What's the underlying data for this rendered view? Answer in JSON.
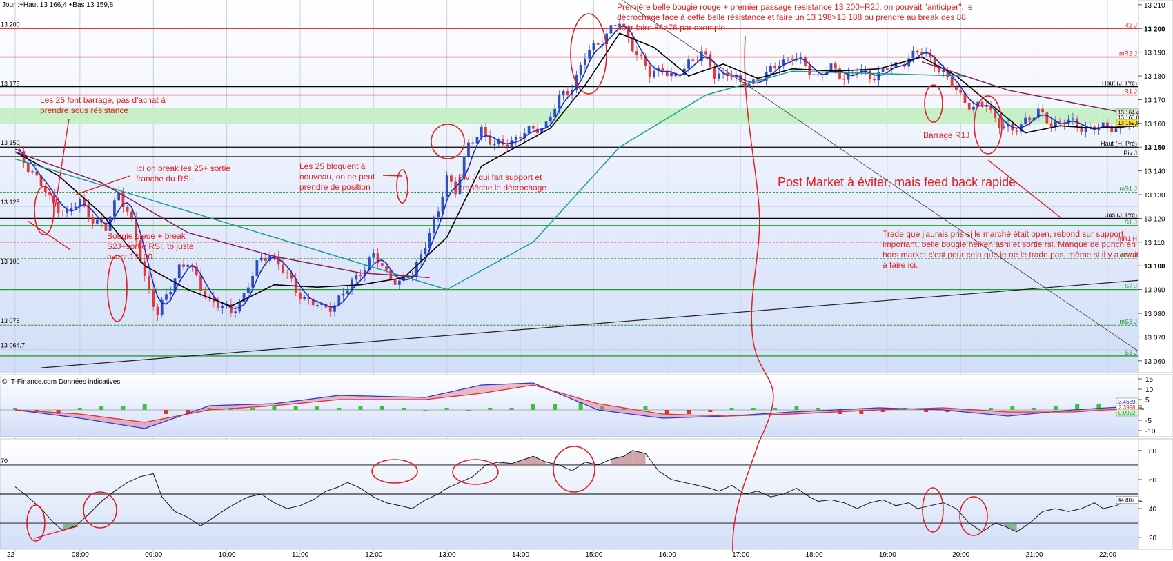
{
  "header": {
    "ohlc": "Jour :+Haut 13 166,4 +Bas 13 159,8",
    "source": "© IT-Finance.com  Données indicatives"
  },
  "colors": {
    "bull": "#2c4fc4",
    "bear": "#e23a3a",
    "ma_fast": "#1a2cc8",
    "ma_slow": "#000000",
    "ma_long1": "#1a9c96",
    "ma_long2": "#8a1a5a",
    "annotation": "#e02020",
    "zone": "#bfeec0",
    "panel_bg_top": "#ffffff",
    "panel_bg_bottom": "#d2def8"
  },
  "annotations": [
    "Première belle bougie rouge + premier passage resistance 13 200+R2J, on pouvait \"anticiper\", le décrochage face à cette belle résistance et faire un 13 198>13 188 ou prendre au break des 88 pour faire 86>76 par exemple",
    "Les 25 font barrage, pas d'achat à prendre sous résistance",
    "Ici on break les 25+ sortie franche du RSI.",
    "Les 25 bloquent à nouveau, on ne peut prendre de position",
    "Piv J qui fait support et empêche le décrochage",
    "Bougie bleue + break S2J+sortie RSI, tp juste avant  13100",
    "Barrage R1J",
    "Post Market à éviter, mais feed back rapide",
    "Trade que j'aurais pris si le marché était open, rebond sur support important, belle bougie heiken ashi et sortie rsi. Manque de punch en hors market c'est pour cela que je ne le trade pas, même si il y a avait à faire ici."
  ],
  "chart_data": [
    {
      "type": "candlestick",
      "x_ticks": [
        "22",
        "08:00",
        "09:00",
        "10:00",
        "11:00",
        "12:00",
        "13:00",
        "14:00",
        "15:00",
        "16:00",
        "17:00",
        "18:00",
        "19:00",
        "20:00",
        "21:00",
        "22:00"
      ],
      "ylim": [
        13055,
        13212
      ],
      "yticks": [
        "13 210",
        "13 200",
        "13 190",
        "13 180",
        "13 170",
        "13 160",
        "13 150",
        "13 140",
        "13 130",
        "13 120",
        "13 110",
        "13 100",
        "13 090",
        "13 080",
        "13 070",
        "13 060"
      ],
      "left_levels": [
        {
          "label": "13 200",
          "y": 13200
        },
        {
          "label": "13 175",
          "y": 13175
        },
        {
          "label": "13 150",
          "y": 13150
        },
        {
          "label": "13 125",
          "y": 13125
        },
        {
          "label": "13 100",
          "y": 13100
        },
        {
          "label": "13 075",
          "y": 13075
        },
        {
          "label": "13 064,7",
          "y": 13064.7
        }
      ],
      "levels": [
        {
          "name": "R2 J",
          "value": 13200,
          "color": "#e02020",
          "style": "solid"
        },
        {
          "name": "mR2 J",
          "value": 13188,
          "color": "#e02020",
          "style": "solid"
        },
        {
          "name": "Haut (J. Pré)",
          "value": 13175.5,
          "color": "#000000",
          "style": "solid"
        },
        {
          "name": "R1 J",
          "value": 13172,
          "color": "#e02020",
          "style": "solid"
        },
        {
          "name": "Haut (H. Pré)",
          "value": 13150,
          "color": "#000000",
          "style": "solid"
        },
        {
          "name": "Piv J",
          "value": 13146,
          "color": "#000000",
          "style": "solid"
        },
        {
          "name": "mS1 J",
          "value": 13131,
          "color": "#1f9c2a",
          "style": "dashed"
        },
        {
          "name": "Bas (J. Pré)",
          "value": 13120,
          "color": "#000000",
          "style": "solid"
        },
        {
          "name": "S1 J",
          "value": 13117,
          "color": "#1f9c2a",
          "style": "solid"
        },
        {
          "name": "mR1 H",
          "value": 13110,
          "color": "#e02020",
          "style": "dashed"
        },
        {
          "name": "mS2 J",
          "value": 13103,
          "color": "#1f9c2a",
          "style": "dashed"
        },
        {
          "name": "S2 J",
          "value": 13090,
          "color": "#1f9c2a",
          "style": "solid"
        },
        {
          "name": "mS3 J",
          "value": 13075,
          "color": "#1f9c2a",
          "style": "dashed"
        },
        {
          "name": "S3 J",
          "value": 13062,
          "color": "#1f9c2a",
          "style": "solid"
        }
      ],
      "price_tags": [
        "13 164,4",
        "13 160,0",
        "13 159,8"
      ],
      "zone": [
        13159.8,
        13166.4
      ],
      "close_path": [
        [
          0,
          13148
        ],
        [
          4,
          13140
        ],
        [
          8,
          13128
        ],
        [
          12,
          13122
        ],
        [
          15,
          13127
        ],
        [
          18,
          13120
        ],
        [
          21,
          13115
        ],
        [
          24,
          13132
        ],
        [
          27,
          13118
        ],
        [
          30,
          13095
        ],
        [
          33,
          13080
        ],
        [
          36,
          13090
        ],
        [
          38,
          13100
        ],
        [
          40,
          13102
        ],
        [
          43,
          13090
        ],
        [
          46,
          13085
        ],
        [
          50,
          13080
        ],
        [
          53,
          13088
        ],
        [
          56,
          13100
        ],
        [
          59,
          13106
        ],
        [
          62,
          13098
        ],
        [
          65,
          13090
        ],
        [
          68,
          13085
        ],
        [
          71,
          13082
        ],
        [
          74,
          13084
        ],
        [
          77,
          13090
        ],
        [
          80,
          13098
        ],
        [
          83,
          13104
        ],
        [
          86,
          13097
        ],
        [
          89,
          13093
        ],
        [
          92,
          13096
        ],
        [
          95,
          13110
        ],
        [
          98,
          13122
        ],
        [
          100,
          13138
        ],
        [
          102,
          13132
        ],
        [
          105,
          13150
        ],
        [
          108,
          13158
        ],
        [
          111,
          13150
        ],
        [
          114,
          13152
        ],
        [
          117,
          13155
        ],
        [
          120,
          13157
        ],
        [
          123,
          13160
        ],
        [
          126,
          13170
        ],
        [
          129,
          13176
        ],
        [
          132,
          13188
        ],
        [
          135,
          13194
        ],
        [
          138,
          13200
        ],
        [
          140,
          13202
        ],
        [
          142,
          13196
        ],
        [
          144,
          13190
        ],
        [
          147,
          13180
        ],
        [
          150,
          13184
        ],
        [
          153,
          13178
        ],
        [
          156,
          13186
        ],
        [
          159,
          13190
        ],
        [
          162,
          13180
        ],
        [
          165,
          13182
        ],
        [
          168,
          13176
        ],
        [
          171,
          13178
        ],
        [
          174,
          13180
        ],
        [
          177,
          13186
        ],
        [
          180,
          13188
        ],
        [
          183,
          13184
        ],
        [
          186,
          13180
        ],
        [
          189,
          13183
        ],
        [
          192,
          13180
        ],
        [
          195,
          13182
        ],
        [
          198,
          13180
        ],
        [
          201,
          13182
        ],
        [
          204,
          13184
        ],
        [
          207,
          13188
        ],
        [
          210,
          13190
        ],
        [
          213,
          13186
        ],
        [
          216,
          13178
        ],
        [
          219,
          13172
        ],
        [
          222,
          13166
        ],
        [
          225,
          13168
        ],
        [
          228,
          13160
        ],
        [
          231,
          13156
        ],
        [
          234,
          13162
        ],
        [
          237,
          13164
        ],
        [
          240,
          13160
        ],
        [
          243,
          13161
        ],
        [
          246,
          13159
        ],
        [
          249,
          13158
        ],
        [
          252,
          13158
        ],
        [
          255,
          13159
        ],
        [
          258,
          13160
        ],
        [
          261,
          13162
        ]
      ],
      "ma_slow_path": [
        [
          0,
          13148
        ],
        [
          10,
          13138
        ],
        [
          20,
          13122
        ],
        [
          30,
          13100
        ],
        [
          40,
          13090
        ],
        [
          50,
          13083
        ],
        [
          60,
          13092
        ],
        [
          70,
          13091
        ],
        [
          80,
          13092
        ],
        [
          90,
          13095
        ],
        [
          100,
          13112
        ],
        [
          108,
          13142
        ],
        [
          116,
          13150
        ],
        [
          124,
          13158
        ],
        [
          132,
          13176
        ],
        [
          140,
          13198
        ],
        [
          148,
          13192
        ],
        [
          156,
          13180
        ],
        [
          164,
          13185
        ],
        [
          172,
          13179
        ],
        [
          180,
          13183
        ],
        [
          190,
          13182
        ],
        [
          200,
          13183
        ],
        [
          210,
          13188
        ],
        [
          218,
          13180
        ],
        [
          226,
          13168
        ],
        [
          234,
          13156
        ],
        [
          242,
          13159
        ],
        [
          250,
          13158
        ],
        [
          261,
          13159
        ]
      ],
      "ma_long1_path": [
        [
          0,
          13145
        ],
        [
          100,
          13090
        ],
        [
          120,
          13110
        ],
        [
          140,
          13150
        ],
        [
          160,
          13172
        ],
        [
          180,
          13182
        ],
        [
          220,
          13180
        ]
      ],
      "ma_long2_path": [
        [
          0,
          13148
        ],
        [
          20,
          13135
        ],
        [
          40,
          13114
        ],
        [
          60,
          13104
        ],
        [
          80,
          13097
        ],
        [
          96,
          13095
        ]
      ],
      "ma_long2b_path": [
        [
          210,
          13186
        ],
        [
          230,
          13174
        ],
        [
          261,
          13163
        ]
      ],
      "trendlines": [
        [
          [
            6,
            13057
          ],
          [
            261,
            13094
          ]
        ],
        [
          [
            130,
            13225
          ],
          [
            261,
            13063
          ]
        ]
      ]
    },
    {
      "type": "histogram",
      "name": "MACD",
      "ylim": [
        -13,
        17
      ],
      "yticks": [
        "15",
        "10",
        "5",
        "-5",
        "-10"
      ],
      "tags": [
        "3,4639",
        "2,3998",
        "0,0922"
      ],
      "histogram": [
        1,
        -1,
        -2,
        1,
        2,
        2,
        3,
        -2,
        -2,
        1,
        1,
        1,
        2,
        2,
        2,
        1,
        2,
        2,
        1,
        0,
        1,
        0,
        1,
        1,
        3,
        3,
        4,
        2,
        1,
        2,
        -2,
        -2,
        -1,
        1,
        1,
        1,
        2,
        1,
        -2,
        -2,
        -1,
        1,
        -1,
        -1,
        0,
        1,
        2,
        1,
        2,
        3,
        3,
        2,
        1
      ],
      "macd_path": [
        [
          0,
          0
        ],
        [
          15,
          -4
        ],
        [
          30,
          -9
        ],
        [
          45,
          2
        ],
        [
          60,
          3
        ],
        [
          75,
          7
        ],
        [
          95,
          6
        ],
        [
          108,
          12
        ],
        [
          120,
          13
        ],
        [
          135,
          0
        ],
        [
          150,
          -4
        ],
        [
          165,
          -3
        ],
        [
          180,
          -1
        ],
        [
          200,
          1
        ],
        [
          215,
          0
        ],
        [
          230,
          -3
        ],
        [
          245,
          0
        ],
        [
          261,
          2
        ]
      ],
      "signal_path": [
        [
          0,
          0
        ],
        [
          15,
          -2
        ],
        [
          30,
          -6
        ],
        [
          45,
          0
        ],
        [
          60,
          2
        ],
        [
          75,
          5
        ],
        [
          95,
          5
        ],
        [
          108,
          8
        ],
        [
          120,
          12
        ],
        [
          135,
          3
        ],
        [
          150,
          -2
        ],
        [
          165,
          -3
        ],
        [
          180,
          -2
        ],
        [
          200,
          0
        ],
        [
          215,
          1
        ],
        [
          230,
          -1
        ],
        [
          245,
          -1
        ],
        [
          261,
          1
        ]
      ]
    },
    {
      "type": "line",
      "name": "RSI",
      "ylim": [
        12,
        88
      ],
      "yticks": [
        "80",
        "60",
        "40",
        "20"
      ],
      "level_label": "70",
      "tag": "44,807",
      "values": [
        55,
        48,
        40,
        30,
        25,
        28,
        36,
        45,
        52,
        58,
        62,
        64,
        48,
        38,
        34,
        28,
        34,
        40,
        45,
        48,
        50,
        44,
        40,
        42,
        46,
        52,
        55,
        58,
        54,
        48,
        44,
        42,
        40,
        46,
        50,
        54,
        58,
        62,
        70,
        72,
        71,
        74,
        76,
        72,
        70,
        66,
        72,
        70,
        74,
        76,
        80,
        78,
        66,
        60,
        58,
        56,
        54,
        52,
        56,
        50,
        52,
        48,
        50,
        54,
        48,
        45,
        46,
        44,
        40,
        44,
        46,
        42,
        44,
        40,
        42,
        44,
        40,
        30,
        24,
        30,
        28,
        24,
        30,
        38,
        40,
        38,
        40,
        44,
        40,
        42,
        46,
        45
      ]
    }
  ]
}
